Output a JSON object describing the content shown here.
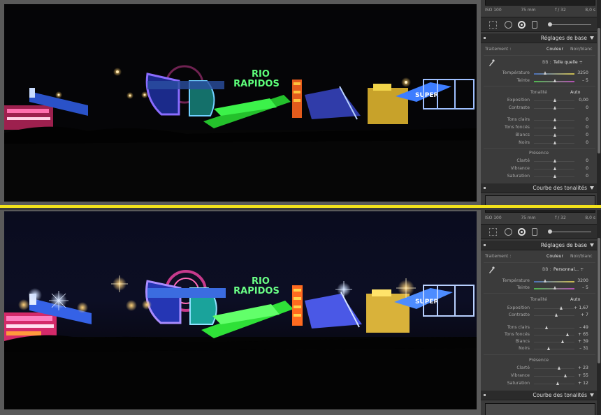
{
  "top_panel": {
    "histogram": {
      "iso": "ISO 100",
      "focal": "75 mm",
      "aperture": "f / 32",
      "shutter": "8,0 s"
    },
    "section_title": "Réglages de base",
    "treatment": {
      "label": "Traitement :",
      "color": "Couleur",
      "bw": "Noir/blanc"
    },
    "wb": {
      "label": "BB :",
      "mode": "Telle quelle ÷"
    },
    "temperature": {
      "label": "Température",
      "value": "3250"
    },
    "tint": {
      "label": "Teinte",
      "value": "– 5"
    },
    "tone_label": "Tonalité",
    "auto": "Auto",
    "exposure": {
      "label": "Exposition",
      "value": "0,00"
    },
    "contrast": {
      "label": "Contraste",
      "value": "0"
    },
    "highlights": {
      "label": "Tons clairs",
      "value": "0"
    },
    "shadows": {
      "label": "Tons foncés",
      "value": "0"
    },
    "whites": {
      "label": "Blancs",
      "value": "0"
    },
    "blacks": {
      "label": "Noirs",
      "value": "0"
    },
    "presence_label": "Présence",
    "clarity": {
      "label": "Clarté",
      "value": "0"
    },
    "vibrance": {
      "label": "Vibrance",
      "value": "0"
    },
    "saturation": {
      "label": "Saturation",
      "value": "0"
    },
    "curve_title": "Courbe des tonalités"
  },
  "bottom_panel": {
    "histogram": {
      "iso": "ISO 100",
      "focal": "75 mm",
      "aperture": "f / 32",
      "shutter": "8,0 s"
    },
    "section_title": "Réglages de base",
    "treatment": {
      "label": "Traitement :",
      "color": "Couleur",
      "bw": "Noir/blanc"
    },
    "wb": {
      "label": "BB :",
      "mode": "Personnal... ÷"
    },
    "temperature": {
      "label": "Température",
      "value": "3200"
    },
    "tint": {
      "label": "Teinte",
      "value": "– 5"
    },
    "tone_label": "Tonalité",
    "auto": "Auto",
    "exposure": {
      "label": "Exposition",
      "value": "+ 1,67"
    },
    "contrast": {
      "label": "Contraste",
      "value": "+ 7"
    },
    "highlights": {
      "label": "Tons clairs",
      "value": "– 49"
    },
    "shadows": {
      "label": "Tons foncés",
      "value": "+ 65"
    },
    "whites": {
      "label": "Blancs",
      "value": "+ 39"
    },
    "blacks": {
      "label": "Noirs",
      "value": "– 31"
    },
    "presence_label": "Présence",
    "clarity": {
      "label": "Clarté",
      "value": "+ 23"
    },
    "vibrance": {
      "label": "Vibrance",
      "value": "+ 55"
    },
    "saturation": {
      "label": "Saturation",
      "value": "+ 12"
    },
    "curve_title": "Courbe des tonalités"
  },
  "photo": {
    "sign_line1": "RIO",
    "sign_line2": "RAPIDOS",
    "ride_sign": "SUPER"
  },
  "colors": {
    "divider": "#f2e21b",
    "panel_bg": "#3b3b3b",
    "sign_green": "#5dff7a"
  }
}
